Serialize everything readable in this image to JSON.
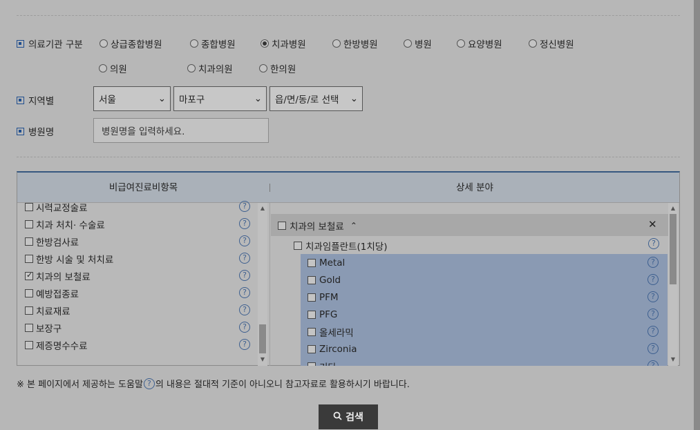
{
  "filters": {
    "institution_type_label": "의료기관 구분",
    "institution_types": [
      {
        "label": "상급종합병원",
        "selected": false
      },
      {
        "label": "종합병원",
        "selected": false
      },
      {
        "label": "치과병원",
        "selected": true
      },
      {
        "label": "한방병원",
        "selected": false
      },
      {
        "label": "병원",
        "selected": false
      },
      {
        "label": "요양병원",
        "selected": false
      },
      {
        "label": "정신병원",
        "selected": false
      },
      {
        "label": "의원",
        "selected": false
      },
      {
        "label": "치과의원",
        "selected": false
      },
      {
        "label": "한의원",
        "selected": false
      }
    ],
    "region_label": "지역별",
    "region_city": "서울",
    "region_district": "마포구",
    "region_town": "읍/면/동/로 선택",
    "hospital_name_label": "병원명",
    "hospital_name_placeholder": "병원명을 입력하세요."
  },
  "categories": {
    "left_header": "비급여진료비항목",
    "right_header": "상세 분야",
    "left_items": [
      {
        "label": "시력교정술료",
        "checked": false
      },
      {
        "label": "치과 처치· 수술료",
        "checked": false
      },
      {
        "label": "한방검사료",
        "checked": false
      },
      {
        "label": "한방 시술 및 처치료",
        "checked": false
      },
      {
        "label": "치과의 보철료",
        "checked": true
      },
      {
        "label": "예방접종료",
        "checked": false
      },
      {
        "label": "치료재료",
        "checked": false
      },
      {
        "label": "보장구",
        "checked": false
      },
      {
        "label": "제증명수수료",
        "checked": false
      }
    ],
    "detail_group": "치과의 보철료",
    "detail_subgroup": "치과임플란트(1치당)",
    "detail_items": [
      "Metal",
      "Gold",
      "PFM",
      "PFG",
      "올세라믹",
      "Zirconia",
      "기타"
    ]
  },
  "help_glyph": "?",
  "footer": {
    "note_prefix": "※ 본 페이지에서 제공하는 도움말",
    "note_suffix": "의 내용은 절대적 기준이 아니오니 참고자료로 활용하시기 바랍니다.",
    "search_label": "검색"
  }
}
